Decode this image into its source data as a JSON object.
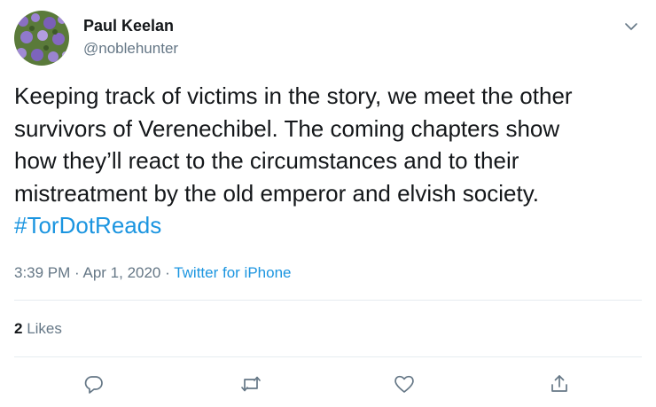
{
  "user": {
    "name": "Paul Keelan",
    "handle": "@noblehunter"
  },
  "tweet": {
    "text": "Keeping track of victims in the story,  we meet the other\nsurvivors of Verenechibel. The coming chapters show\nhow they’ll react to the circumstances and to their\nmistreatment by the old emperor and elvish society.\n",
    "hashtag": "#TorDotReads"
  },
  "meta": {
    "time": "3:39 PM",
    "sep1": " · ",
    "date": "Apr 1, 2020",
    "sep2": " · ",
    "source": "Twitter for iPhone"
  },
  "stats": {
    "likes_count": "2",
    "likes_label": "Likes"
  },
  "actions": {
    "reply_icon": "reply-icon",
    "retweet_icon": "retweet-icon",
    "like_icon": "heart-icon",
    "share_icon": "share-icon"
  },
  "colors": {
    "link": "#1b95e0",
    "muted": "#657786",
    "text": "#14171a",
    "divider": "#e6ecf0"
  }
}
